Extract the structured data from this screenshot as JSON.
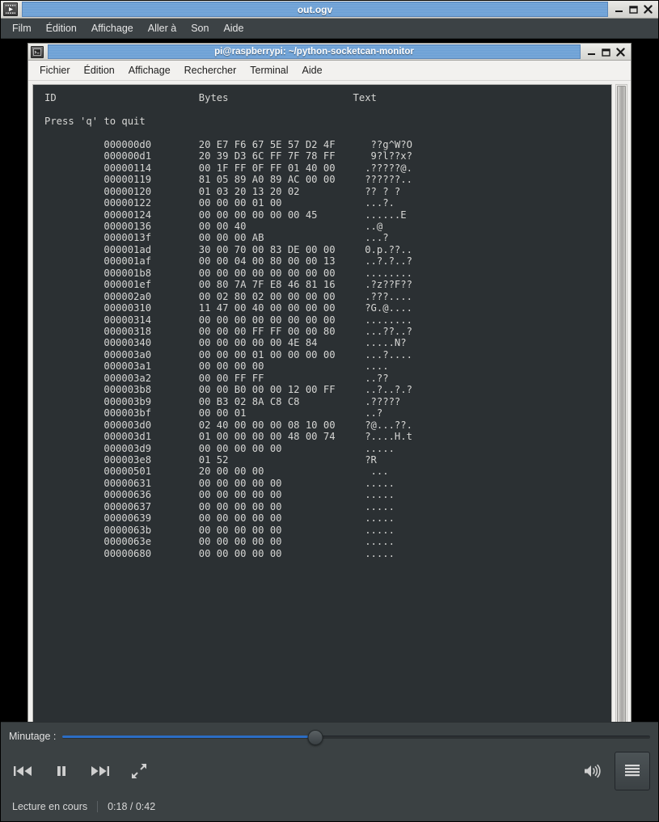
{
  "player": {
    "title": "out.ogv",
    "icon": "film-play-icon",
    "window_buttons": [
      {
        "name": "minimize-button",
        "glyph": "minimize"
      },
      {
        "name": "maximize-button",
        "glyph": "maximize"
      },
      {
        "name": "close-button",
        "glyph": "close"
      }
    ],
    "menu": [
      {
        "label": "Film"
      },
      {
        "label": "Édition"
      },
      {
        "label": "Affichage"
      },
      {
        "label": "Aller à"
      },
      {
        "label": "Son"
      },
      {
        "label": "Aide"
      }
    ],
    "seek": {
      "label": "Minutage :",
      "position_percent": 43
    },
    "controls": [
      {
        "name": "previous-button",
        "icon": "skip-previous-icon"
      },
      {
        "name": "pause-button",
        "icon": "pause-icon"
      },
      {
        "name": "next-button",
        "icon": "skip-next-icon"
      },
      {
        "name": "fullscreen-button",
        "icon": "fullscreen-expand-icon"
      }
    ],
    "volume": {
      "name": "volume-button",
      "icon": "volume-high-icon"
    },
    "menu_button": {
      "name": "player-menu-button",
      "icon": "hamburger-menu-icon"
    },
    "status": {
      "state": "Lecture en cours",
      "time": "0:18 / 0:42"
    },
    "accent_color": "#2b6dc4",
    "titlebar_color": "#6b9fd4"
  },
  "terminal": {
    "title": "pi@raspberrypi: ~/python-socketcan-monitor",
    "icon": "terminal-icon",
    "window_buttons": [
      {
        "name": "minimize-button",
        "glyph": "minimize"
      },
      {
        "name": "maximize-button",
        "glyph": "maximize"
      },
      {
        "name": "close-button",
        "glyph": "close"
      }
    ],
    "menu": [
      {
        "label": "Fichier"
      },
      {
        "label": "Édition"
      },
      {
        "label": "Affichage"
      },
      {
        "label": "Rechercher"
      },
      {
        "label": "Terminal"
      },
      {
        "label": "Aide"
      }
    ],
    "background_color": "#2b3033",
    "foreground_color": "#d6d6d4",
    "header": {
      "id": "ID",
      "bytes": "Bytes",
      "text": "Text"
    },
    "hint": "Press 'q' to quit",
    "rows": [
      {
        "id": "000000d0",
        "bytes": "20 E7 F6 67 5E 57 D2 4F",
        "text": " ??g^W?O"
      },
      {
        "id": "000000d1",
        "bytes": "20 39 D3 6C FF 7F 78 FF",
        "text": " 9?l??x?"
      },
      {
        "id": "00000114",
        "bytes": "00 1F FF 0F FF 01 40 00",
        "text": ".?????@."
      },
      {
        "id": "00000119",
        "bytes": "81 05 89 A0 89 AC 00 00",
        "text": "??????.."
      },
      {
        "id": "00000120",
        "bytes": "01 03 20 13 20 02",
        "text": "?? ? ?"
      },
      {
        "id": "00000122",
        "bytes": "00 00 00 01 00",
        "text": "...?."
      },
      {
        "id": "00000124",
        "bytes": "00 00 00 00 00 00 45",
        "text": "......E"
      },
      {
        "id": "00000136",
        "bytes": "00 00 40",
        "text": "..@"
      },
      {
        "id": "0000013f",
        "bytes": "00 00 00 AB",
        "text": "...?"
      },
      {
        "id": "000001ad",
        "bytes": "30 00 70 00 83 DE 00 00",
        "text": "0.p.??.."
      },
      {
        "id": "000001af",
        "bytes": "00 00 04 00 80 00 00 13",
        "text": "..?.?..?"
      },
      {
        "id": "000001b8",
        "bytes": "00 00 00 00 00 00 00 00",
        "text": "........"
      },
      {
        "id": "000001ef",
        "bytes": "00 80 7A 7F E8 46 81 16",
        "text": ".?z??F??"
      },
      {
        "id": "000002a0",
        "bytes": "00 02 80 02 00 00 00 00",
        "text": ".???...."
      },
      {
        "id": "00000310",
        "bytes": "11 47 00 40 00 00 00 00",
        "text": "?G.@...."
      },
      {
        "id": "00000314",
        "bytes": "00 00 00 00 00 00 00 00",
        "text": "........"
      },
      {
        "id": "00000318",
        "bytes": "00 00 00 FF FF 00 00 80",
        "text": "...??..?"
      },
      {
        "id": "00000340",
        "bytes": "00 00 00 00 00 4E 84",
        "text": ".....N?"
      },
      {
        "id": "000003a0",
        "bytes": "00 00 00 01 00 00 00 00",
        "text": "...?...."
      },
      {
        "id": "000003a1",
        "bytes": "00 00 00 00",
        "text": "...."
      },
      {
        "id": "000003a2",
        "bytes": "00 00 FF FF",
        "text": "..??"
      },
      {
        "id": "000003b8",
        "bytes": "00 00 B0 00 00 12 00 FF",
        "text": "..?..?.?"
      },
      {
        "id": "000003b9",
        "bytes": "00 B3 02 8A C8 C8",
        "text": ".?????"
      },
      {
        "id": "000003bf",
        "bytes": "00 00 01",
        "text": "..?"
      },
      {
        "id": "000003d0",
        "bytes": "02 40 00 00 00 08 10 00",
        "text": "?@...??."
      },
      {
        "id": "000003d1",
        "bytes": "01 00 00 00 00 48 00 74",
        "text": "?....H.t"
      },
      {
        "id": "000003d9",
        "bytes": "00 00 00 00 00",
        "text": "....."
      },
      {
        "id": "000003e8",
        "bytes": "01 52",
        "text": "?R"
      },
      {
        "id": "00000501",
        "bytes": "20 00 00 00",
        "text": " ..."
      },
      {
        "id": "00000631",
        "bytes": "00 00 00 00 00",
        "text": "....."
      },
      {
        "id": "00000636",
        "bytes": "00 00 00 00 00",
        "text": "....."
      },
      {
        "id": "00000637",
        "bytes": "00 00 00 00 00",
        "text": "....."
      },
      {
        "id": "00000639",
        "bytes": "00 00 00 00 00",
        "text": "....."
      },
      {
        "id": "0000063b",
        "bytes": "00 00 00 00 00",
        "text": "....."
      },
      {
        "id": "0000063e",
        "bytes": "00 00 00 00 00",
        "text": "....."
      },
      {
        "id": "00000680",
        "bytes": "00 00 00 00 00",
        "text": "....."
      }
    ]
  }
}
